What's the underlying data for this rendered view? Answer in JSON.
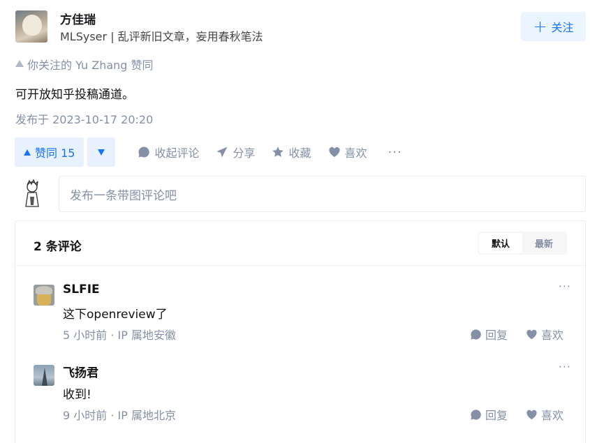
{
  "author": {
    "name": "方佳瑞",
    "bio": "MLSyser | 乱评新旧文章，妄用春秋笔法"
  },
  "follow": {
    "icon": "plus-icon",
    "label": "关注"
  },
  "endorsement": "你关注的 Yu Zhang 赞同",
  "content": "可开放知乎投稿通道。",
  "published": "发布于 2023-10-17 20:20",
  "actions": {
    "vote_up": "赞同 15",
    "collapse_comments": "收起评论",
    "share": "分享",
    "favorite": "收藏",
    "like": "喜欢",
    "more": "···"
  },
  "composer": {
    "placeholder": "发布一条带图评论吧"
  },
  "comments_box": {
    "title": "2 条评论",
    "sort": {
      "default": "默认",
      "latest": "最新",
      "selected": "默认"
    },
    "items": [
      {
        "name": "SLFIE",
        "text": "这下openreview了",
        "meta": "5 小时前 · IP 属地安徽",
        "reply": "回复",
        "like": "喜欢",
        "more": "···"
      },
      {
        "name": "飞扬君",
        "text": "收到!",
        "meta": "9 小时前 · IP 属地北京",
        "reply": "回复",
        "like": "喜欢",
        "more": "···"
      }
    ]
  },
  "colors": {
    "accent": "#1772f6",
    "accent_bg": "#ebf5ff",
    "muted": "#8590a6"
  }
}
